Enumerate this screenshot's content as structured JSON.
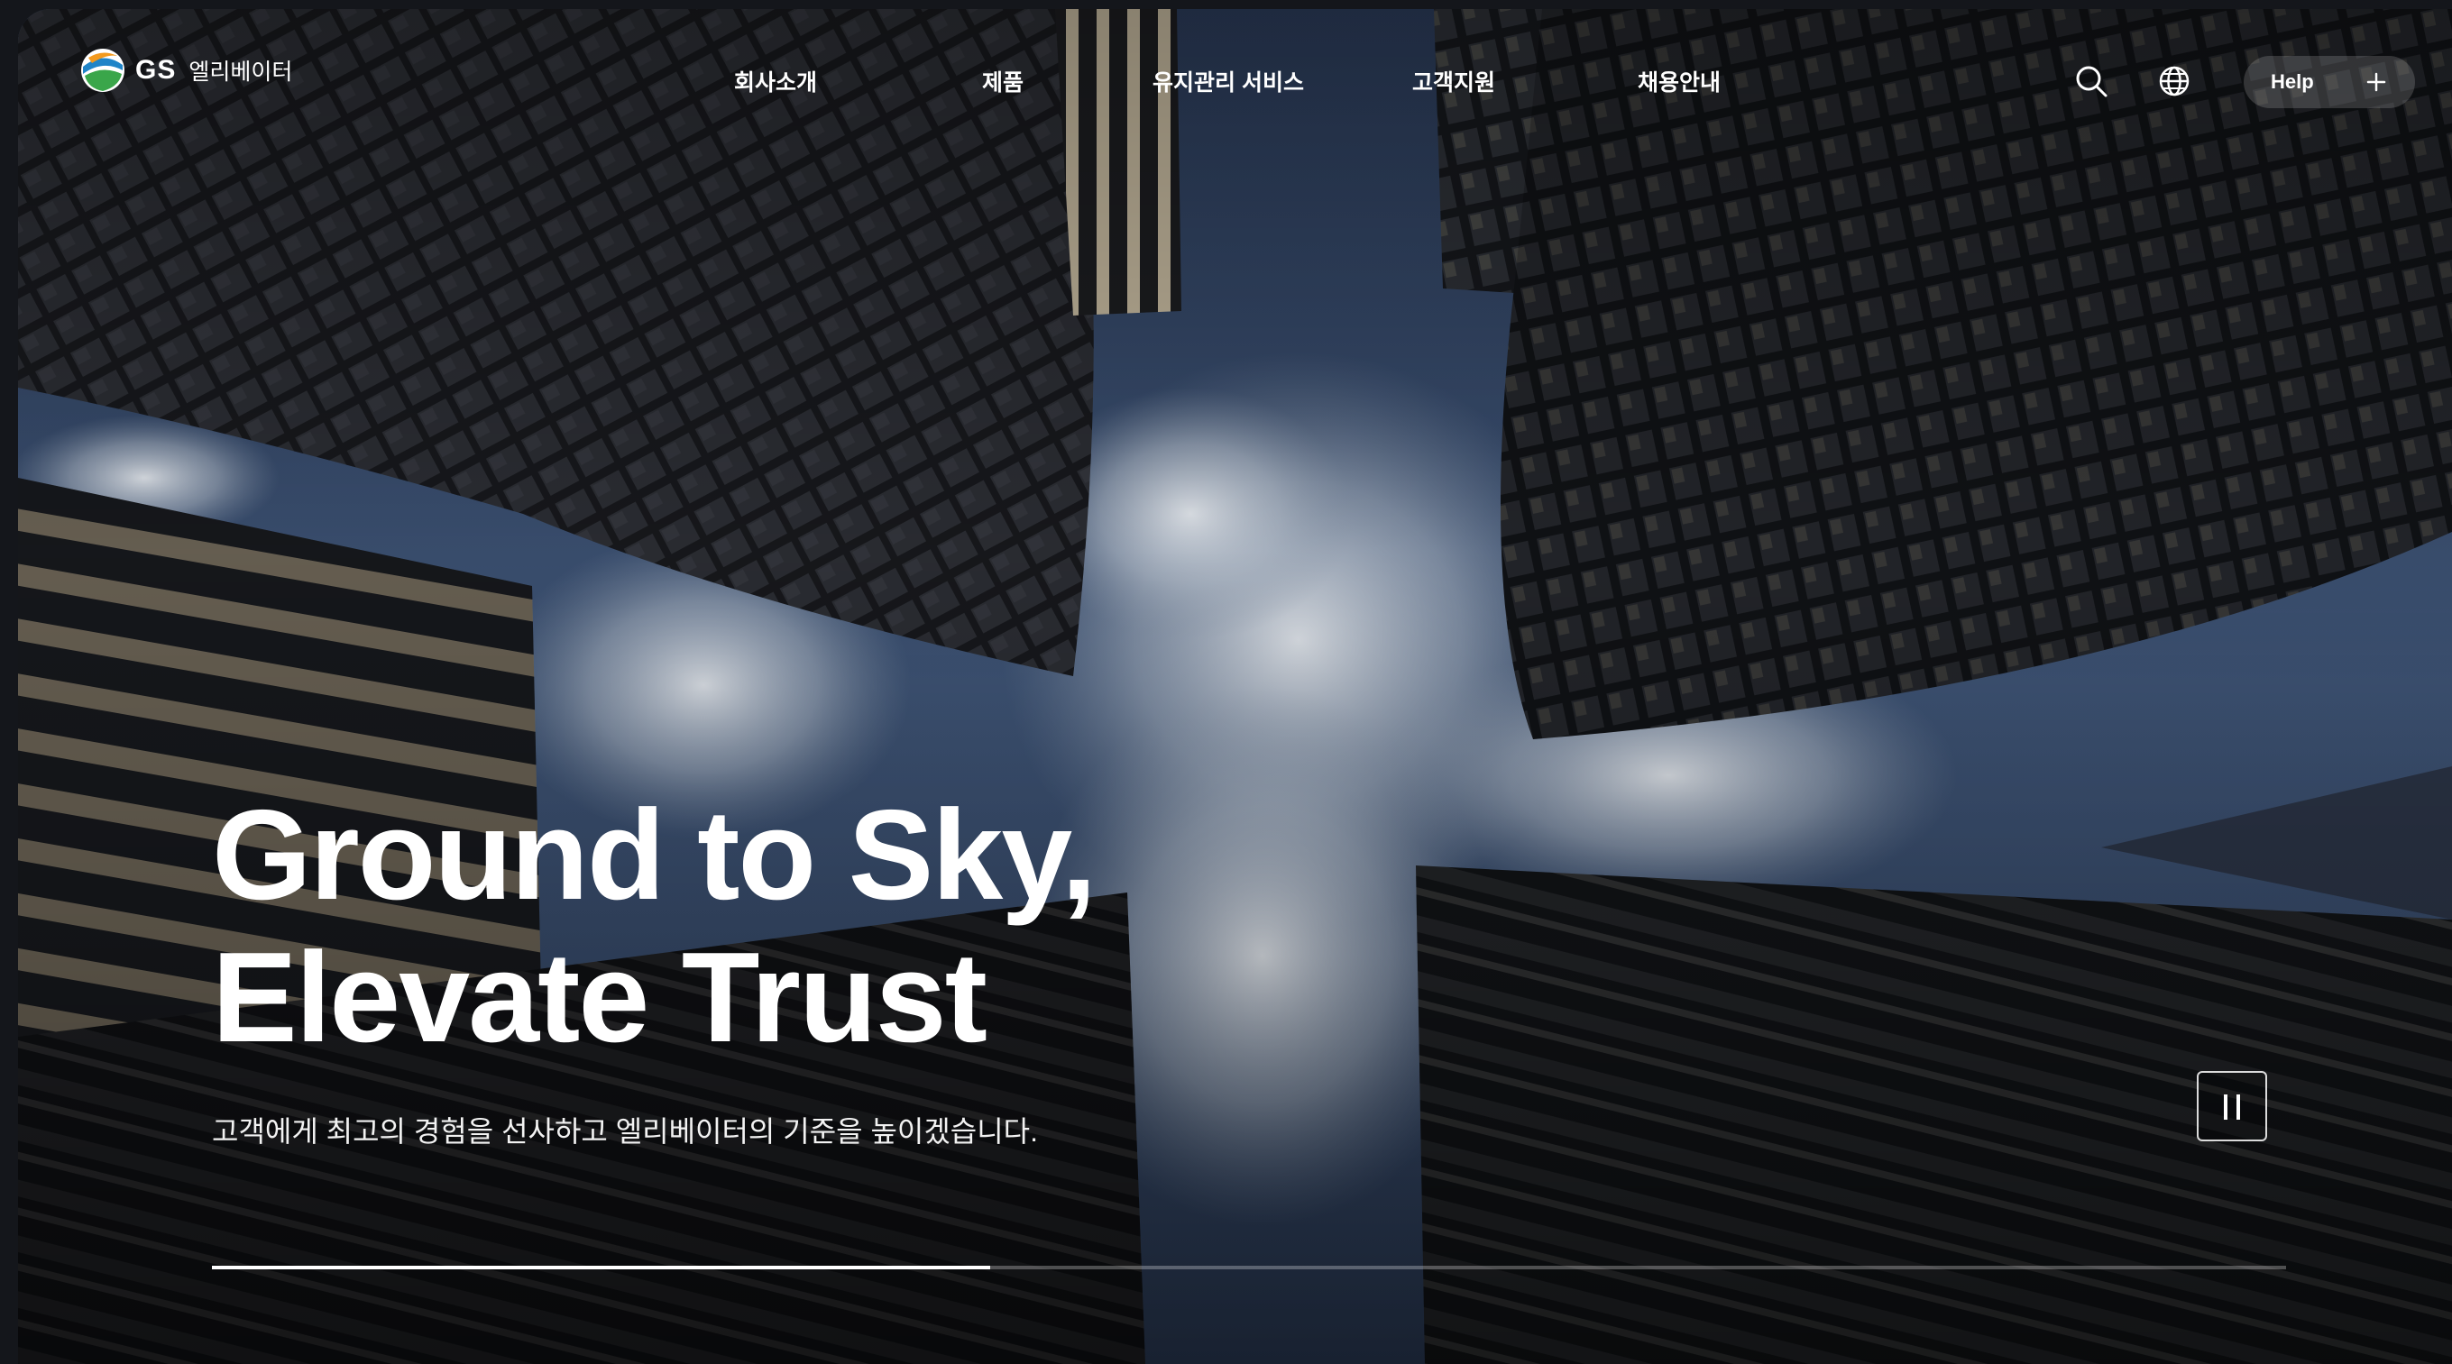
{
  "header": {
    "logo_gs": "GS",
    "logo_sub": "엘리베이터",
    "nav": [
      {
        "label": "회사소개"
      },
      {
        "label": "제품"
      },
      {
        "label": "유지관리 서비스"
      },
      {
        "label": "고객지원"
      },
      {
        "label": "채용안내"
      }
    ],
    "search_icon": "search-icon",
    "globe_icon": "globe-icon",
    "help_label": "Help",
    "help_icon": "plus-icon"
  },
  "hero": {
    "headline_line1": "Ground to Sky,",
    "headline_line2": "Elevate Trust",
    "subtitle": "고객에게 최고의 경험을 선사하고 엘리베이터의 기준을 높이겠습니다.",
    "pause_icon": "pause-icon",
    "slide_progress": 0.375
  },
  "colors": {
    "text": "#ffffff",
    "sky": "#3a4d6e",
    "building": "#1b1d22"
  }
}
